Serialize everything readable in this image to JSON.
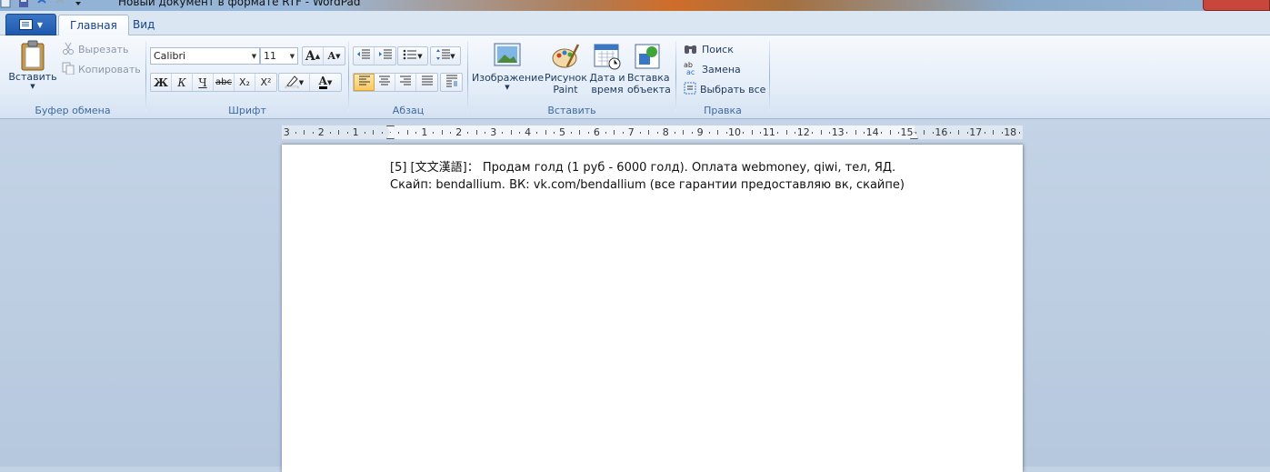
{
  "window": {
    "title": "Новый документ в формате RTF - WordPad"
  },
  "tabs": [
    {
      "label": "Главная",
      "active": true
    },
    {
      "label": "Вид",
      "active": false
    }
  ],
  "clipboard": {
    "paste": "Вставить",
    "cut": "Вырезать",
    "copy": "Копировать",
    "group_label": "Буфер обмена"
  },
  "font": {
    "family": "Calibri",
    "size": "11",
    "bold": "Ж",
    "italic": "К",
    "underline": "Ч",
    "strikethrough": "abc",
    "subscript": "X₂",
    "superscript": "X²",
    "font_color_letter": "A",
    "grow_letter": "A",
    "shrink_letter": "A",
    "group_label": "Шрифт"
  },
  "paragraph": {
    "group_label": "Абзац"
  },
  "insert": {
    "picture": "Изображение",
    "paint_line1": "Рисунок",
    "paint_line2": "Paint",
    "datetime_line1": "Дата и",
    "datetime_line2": "время",
    "object_line1": "Вставка",
    "object_line2": "объекта",
    "group_label": "Вставить"
  },
  "editing": {
    "find": "Поиск",
    "replace": "Замена",
    "select_all": "Выбрать все",
    "group_label": "Правка"
  },
  "ruler": {
    "labels": [
      "3",
      "2",
      "1",
      "1",
      "2",
      "3",
      "4",
      "5",
      "6",
      "7",
      "8",
      "9",
      "10",
      "11",
      "12",
      "13",
      "14",
      "15",
      "16",
      "17",
      "18"
    ]
  },
  "document": {
    "text": "[5] [文文漢語]： Продам голд (1 руб - 6000 голд). Оплата webmoney, qiwi, тел, ЯД. Скайп: bendallium. ВК: vk.com/bendallium (все гарантии предоставляю вк, скайпе)"
  },
  "colors": {
    "ribbon_bg": "#dfe9f5",
    "workspace_bg": "#c4d3e6",
    "active_align": "#f9c861",
    "font_color_bar": "#000000"
  }
}
